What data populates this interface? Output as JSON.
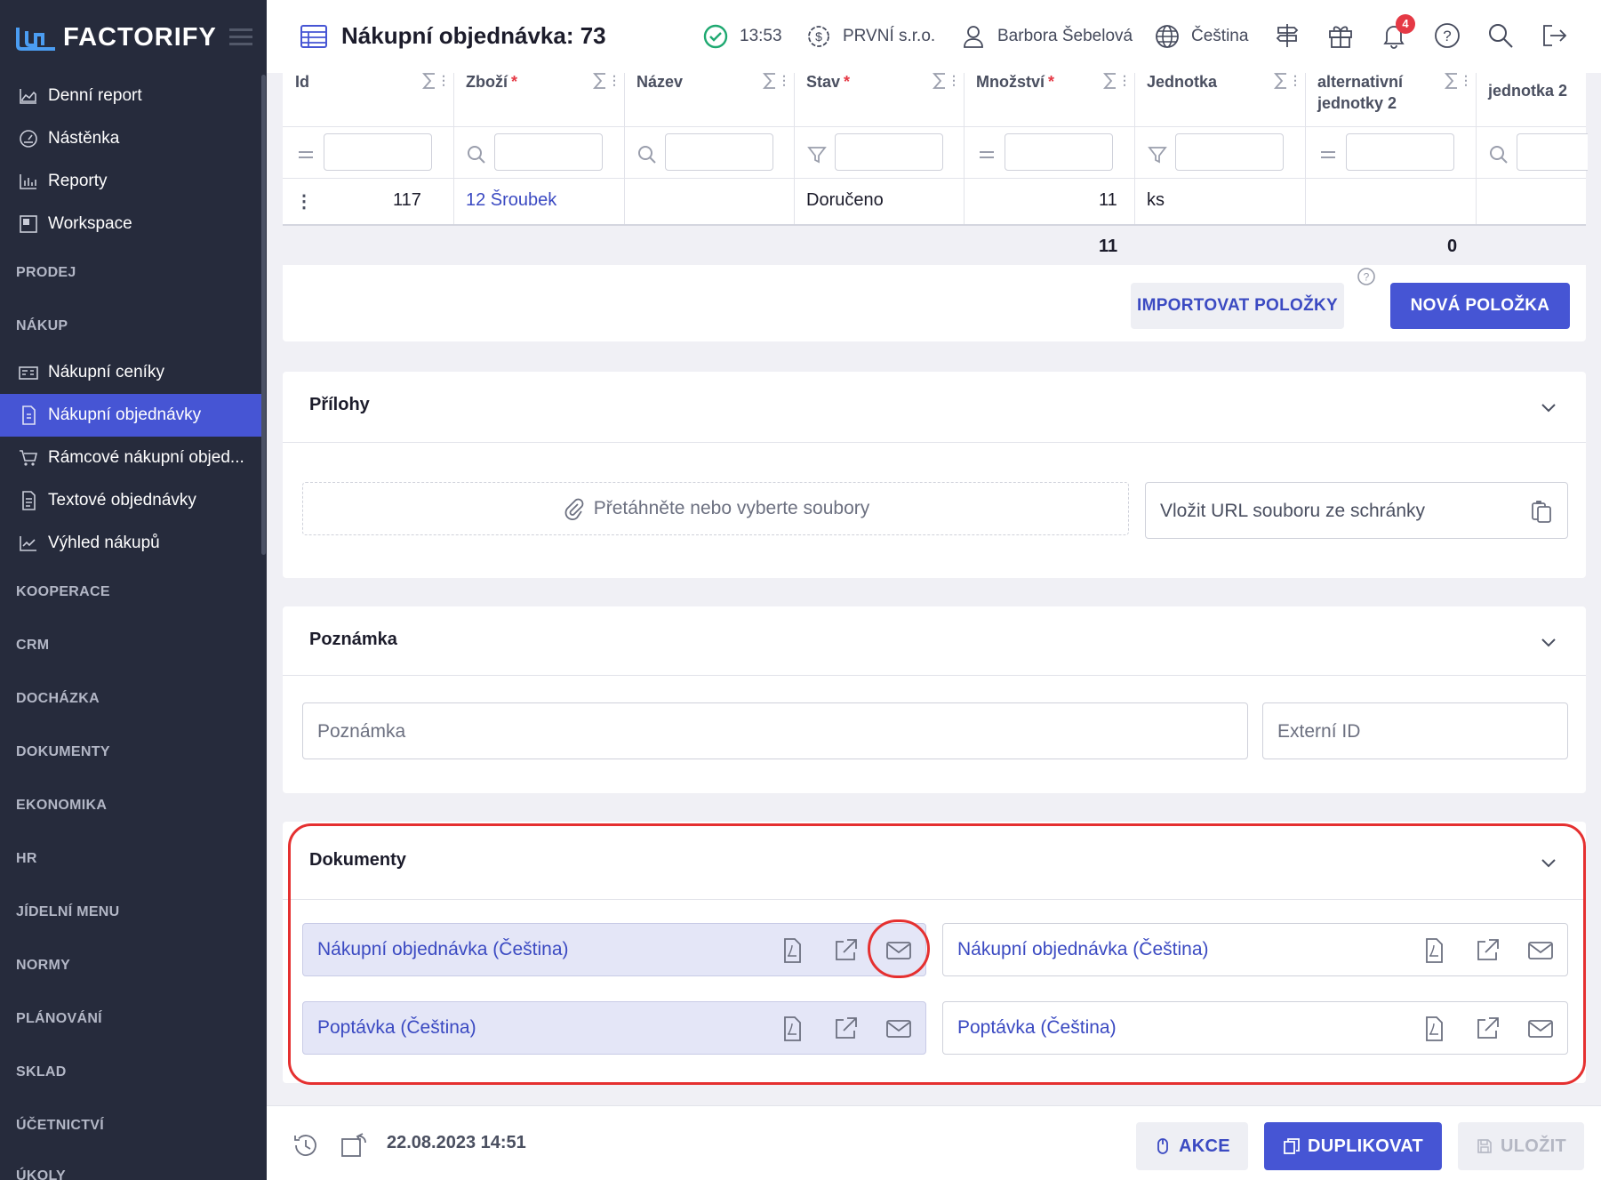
{
  "brand": {
    "name": "FACTORIFY"
  },
  "sidebar": {
    "items": [
      {
        "label": "Denní report",
        "icon": "chart-area-icon"
      },
      {
        "label": "Nástěnka",
        "icon": "dashboard-gauge-icon"
      },
      {
        "label": "Reporty",
        "icon": "bar-chart-icon"
      },
      {
        "label": "Workspace",
        "icon": "workspace-icon"
      }
    ],
    "section_prodej": "PRODEJ",
    "section_nakup": "NÁKUP",
    "nakup_items": [
      {
        "label": "Nákupní ceníky",
        "icon": "price-list-icon"
      },
      {
        "label": "Nákupní objednávky",
        "icon": "order-document-icon",
        "active": true
      },
      {
        "label": "Rámcové nákupní objed...",
        "icon": "cart-icon"
      },
      {
        "label": "Textové objednávky",
        "icon": "text-document-icon"
      },
      {
        "label": "Výhled nákupů",
        "icon": "trend-chart-icon"
      }
    ],
    "sections": [
      "KOOPERACE",
      "CRM",
      "DOCHÁZKA",
      "DOKUMENTY",
      "EKONOMIKA",
      "HR",
      "JÍDELNÍ MENU",
      "NORMY",
      "PLÁNOVÁNÍ",
      "SKLAD",
      "ÚČETNICTVÍ",
      "ÚKOLY"
    ]
  },
  "header": {
    "title": "Nákupní objednávka: 73",
    "time": "13:53",
    "company": "PRVNÍ s.r.o.",
    "user": "Barbora Šebelová",
    "language": "Čeština",
    "notifications_count": "4"
  },
  "table": {
    "columns": [
      {
        "label": "Id",
        "required": false
      },
      {
        "label": "Zboží",
        "required": true
      },
      {
        "label": "Název",
        "required": false
      },
      {
        "label": "Stav",
        "required": true
      },
      {
        "label": "Množství",
        "required": true
      },
      {
        "label": "Jednotka",
        "required": false
      },
      {
        "label": "alternativní jednotky 2",
        "required": false
      },
      {
        "label": "jednotka 2",
        "required": false
      }
    ],
    "row": {
      "id": "117",
      "product": "12 Šroubek",
      "name": "",
      "state": "Doručeno",
      "quantity": "11",
      "unit": "ks",
      "alt_units": "",
      "unit2": ""
    },
    "summary": {
      "quantity": "11",
      "alt_units": "0"
    },
    "import_label": "IMPORTOVAT POLOŽKY",
    "new_label": "NOVÁ POLOŽKA"
  },
  "attachments": {
    "title": "Přílohy",
    "drop_label": "Přetáhněte nebo vyberte soubory",
    "url_placeholder": "Vložit URL souboru ze schránky"
  },
  "note": {
    "title": "Poznámka",
    "note_placeholder": "Poznámka",
    "external_placeholder": "Externí ID"
  },
  "documents": {
    "title": "Dokumenty",
    "items": [
      {
        "label": "Nákupní objednávka (Čeština)",
        "highlighted": true
      },
      {
        "label": "Nákupní objednávka (Čeština)",
        "highlighted": false
      },
      {
        "label": "Poptávka (Čeština)",
        "highlighted": true
      },
      {
        "label": "Poptávka (Čeština)",
        "highlighted": false
      }
    ]
  },
  "footer": {
    "date": "22.08.2023 14:51",
    "action_label": "AKCE",
    "duplicate_label": "DUPLIKOVAT",
    "save_label": "ULOŽIT"
  },
  "colors": {
    "accent": "#4655d4",
    "sidebar": "#262b3c",
    "annotation": "#e53030",
    "success": "#1fa971"
  }
}
